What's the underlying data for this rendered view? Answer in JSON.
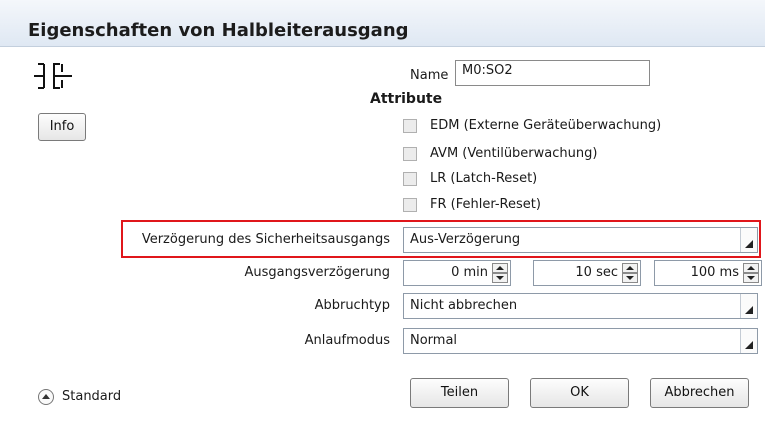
{
  "dialog": {
    "title": "Eigenschaften von Halbleiterausgang",
    "symbol_icon": "semiconductor-output-symbol-icon",
    "info_label": "Info"
  },
  "name_field": {
    "label": "Name",
    "value": "M0:SO2"
  },
  "attributes": {
    "heading": "Attribute",
    "items": [
      {
        "label": "EDM (Externe Geräteüberwachung)",
        "checked": false
      },
      {
        "label": "AVM (Ventilüberwachung)",
        "checked": false
      },
      {
        "label": "LR (Latch-Reset)",
        "checked": false
      },
      {
        "label": "FR (Fehler-Reset)",
        "checked": false
      }
    ]
  },
  "safety_delay": {
    "label": "Verzögerung des Sicherheitsausgangs",
    "value": "Aus-Verzögerung",
    "highlight_color": "#e0161b"
  },
  "output_delay": {
    "label": "Ausgangsverzögerung",
    "minutes": "0 min",
    "seconds": "10 sec",
    "milliseconds": "100 ms"
  },
  "abort_type": {
    "label": "Abbruchtyp",
    "value": "Nicht abbrechen"
  },
  "startup_mode": {
    "label": "Anlaufmodus",
    "value": "Normal"
  },
  "footer": {
    "standard_label": "Standard",
    "share_label": "Teilen",
    "ok_label": "OK",
    "cancel_label": "Abbrechen"
  }
}
